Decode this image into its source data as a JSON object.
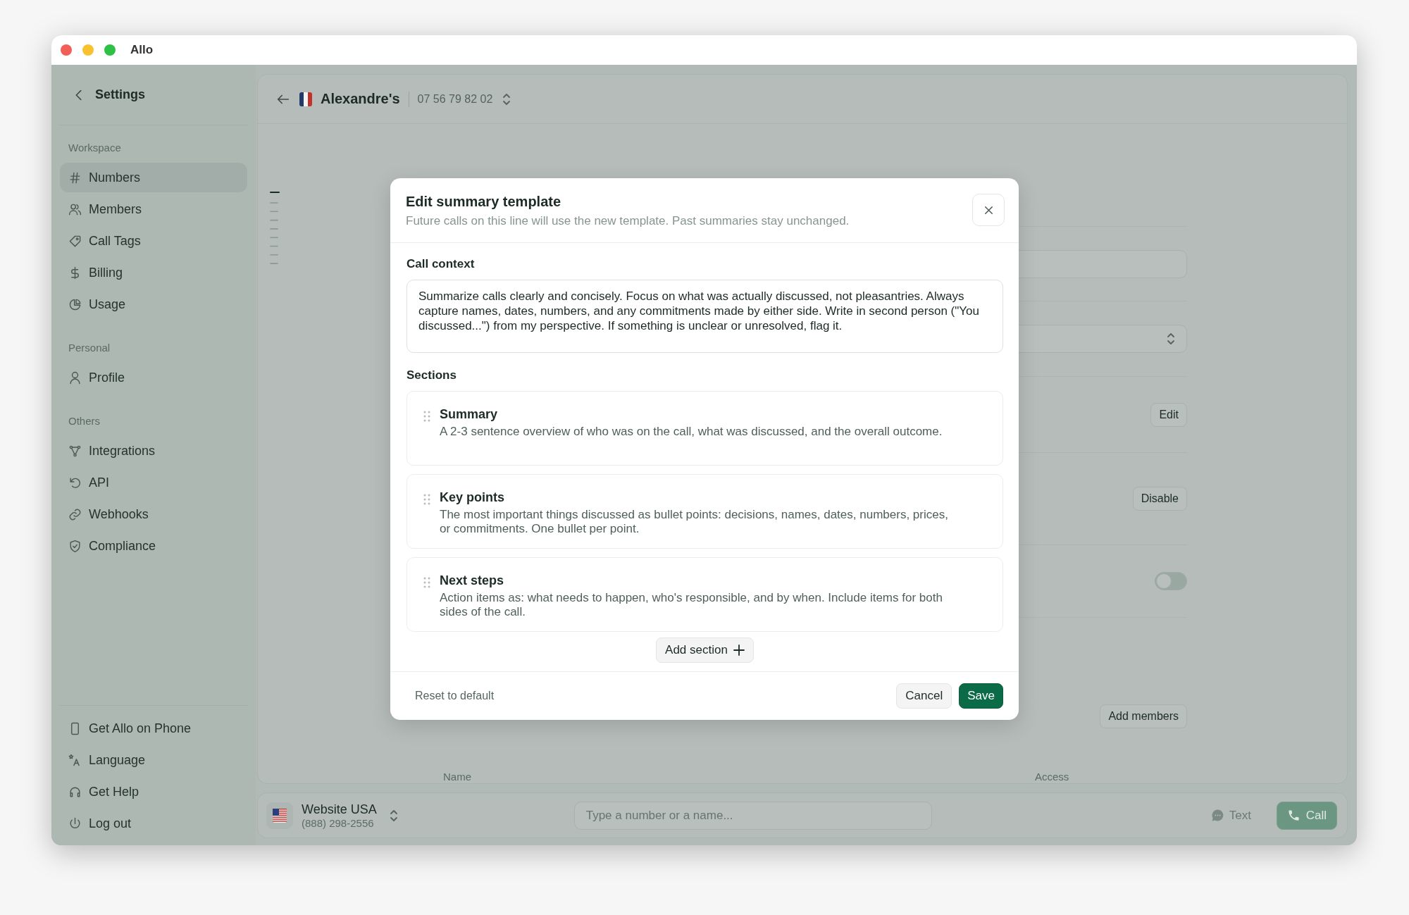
{
  "window": {
    "title": "Allo"
  },
  "sidebar": {
    "back_label": "Settings",
    "groups": [
      {
        "heading": "Workspace",
        "items": [
          {
            "label": "Numbers",
            "selected": true
          },
          {
            "label": "Members",
            "selected": false
          },
          {
            "label": "Call Tags",
            "selected": false
          },
          {
            "label": "Billing",
            "selected": false
          },
          {
            "label": "Usage",
            "selected": false
          }
        ]
      },
      {
        "heading": "Personal",
        "items": [
          {
            "label": "Profile",
            "selected": false
          }
        ]
      },
      {
        "heading": "Others",
        "items": [
          {
            "label": "Integrations",
            "selected": false
          },
          {
            "label": "API",
            "selected": false
          },
          {
            "label": "Webhooks",
            "selected": false
          },
          {
            "label": "Compliance",
            "selected": false
          }
        ]
      }
    ],
    "footer_items": [
      {
        "label": "Get Allo on Phone"
      },
      {
        "label": "Language"
      },
      {
        "label": "Get Help"
      },
      {
        "label": "Log out"
      }
    ]
  },
  "line_header": {
    "name": "Alexandre's",
    "phone": "07 56 79 82 02"
  },
  "background_rows": [
    {
      "kind": "input"
    },
    {
      "kind": "select"
    },
    {
      "kind": "button",
      "label": "Edit"
    },
    {
      "kind": "button",
      "label": "Disable"
    },
    {
      "kind": "toggle",
      "on": false
    },
    {
      "kind": "button",
      "label": "Add members"
    }
  ],
  "table": {
    "columns": [
      "Name",
      "Access"
    ]
  },
  "dialog": {
    "title": "Edit summary template",
    "subtitle": "Future calls on this line will use the new template. Past summaries stay unchanged.",
    "context_label": "Call context",
    "context_value": "Summarize calls clearly and concisely. Focus on what was actually discussed, not pleasantries. Always capture names, dates, numbers, and any commitments made by either side. Write in second person (\"You discussed...\") from my perspective. If something is unclear or unresolved, flag it.",
    "sections_label": "Sections",
    "sections": [
      {
        "title": "Summary",
        "description": "A 2-3 sentence overview of who was on the call, what was discussed, and the overall outcome."
      },
      {
        "title": "Key points",
        "description": "The most important things discussed as bullet points: decisions, names, dates, numbers, prices, or commitments. One bullet per point."
      },
      {
        "title": "Next steps",
        "description": "Action items as: what needs to happen, who's responsible, and by when. Include items for both sides of the call."
      }
    ],
    "add_section": "Add section",
    "reset": "Reset to default",
    "cancel": "Cancel",
    "save": "Save"
  },
  "bottom_bar": {
    "line_name": "Website USA",
    "line_number": "(888) 298-2556",
    "dial_placeholder": "Type a number or a name...",
    "text_button": "Text",
    "call_button": "Call"
  }
}
